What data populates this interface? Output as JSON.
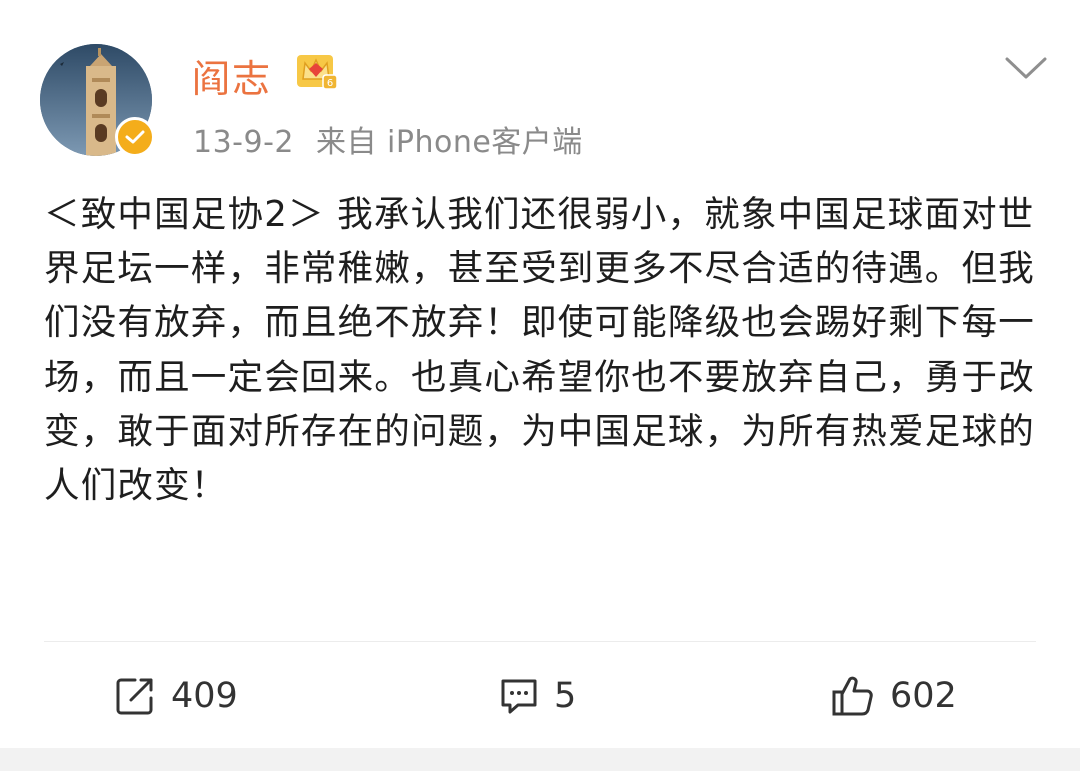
{
  "post": {
    "author": {
      "name": "阎志",
      "avatar_icon": "tower-avatar",
      "verified_icon": "verified-badge-icon",
      "vip_icon": "vip-crown-icon"
    },
    "date": "13-9-2",
    "source": "来自 iPhone客户端",
    "text": "＜致中国足协2＞ 我承认我们还很弱小，就象中国足球面对世界足坛一样，非常稚嫩，甚至受到更多不尽合适的待遇。但我们没有放弃，而且绝不放弃！即使可能降级也会踢好剩下每一场，而且一定会回来。也真心希望你也不要放弃自己，勇于改变，敢于面对所存在的问题，为中国足球，为所有热爱足球的人们改变！"
  },
  "actions": {
    "repost": {
      "icon": "share-icon",
      "count": "409"
    },
    "comment": {
      "icon": "comment-icon",
      "count": "5"
    },
    "like": {
      "icon": "thumbs-up-icon",
      "count": "602"
    }
  },
  "colors": {
    "username": "#eb7340",
    "verified": "#f4ad1b",
    "meta": "#8a8a8a"
  }
}
